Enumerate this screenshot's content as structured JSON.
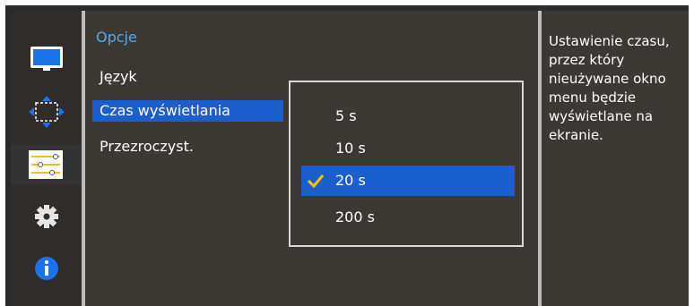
{
  "sidebar": {
    "items": [
      {
        "icon": "monitor-icon"
      },
      {
        "icon": "position-arrows-icon"
      },
      {
        "icon": "options-sliders-icon",
        "selected": true
      },
      {
        "icon": "gear-icon"
      },
      {
        "icon": "info-icon"
      }
    ]
  },
  "menu": {
    "title": "Opcje",
    "items": [
      {
        "label": "Język"
      },
      {
        "label": "Czas wyświetlania",
        "active": true
      },
      {
        "label": "Przezroczyst."
      }
    ]
  },
  "dropdown": {
    "options": [
      {
        "label": "5 s"
      },
      {
        "label": "10 s"
      },
      {
        "label": "20 s",
        "selected": true
      },
      {
        "label": "200 s"
      }
    ]
  },
  "help": {
    "text": "Ustawienie czasu, przez który nieużywane okno menu będzie wyświetlane na ekranie."
  },
  "colors": {
    "accent": "#1b5fcf",
    "title": "#58a8ee",
    "check": "#f2c400"
  }
}
